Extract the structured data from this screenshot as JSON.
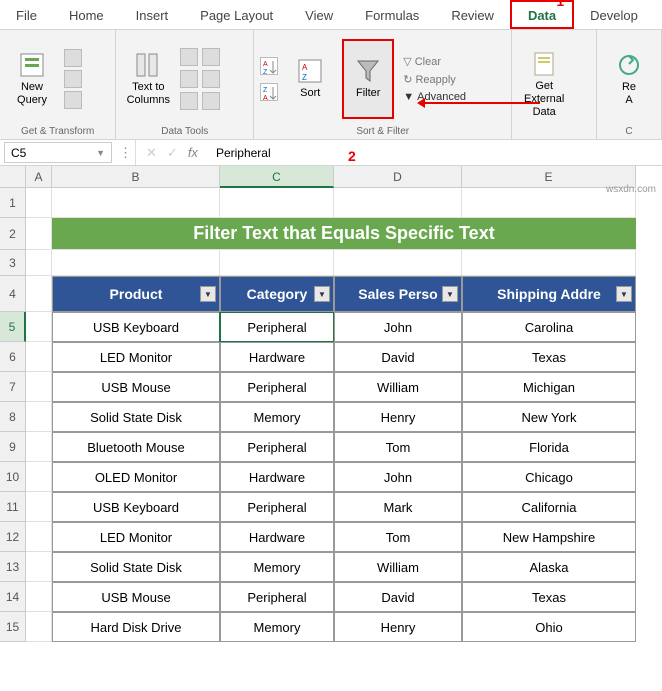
{
  "ribbon": {
    "tabs": [
      "File",
      "Home",
      "Insert",
      "Page Layout",
      "View",
      "Formulas",
      "Review",
      "Data",
      "Develop"
    ],
    "active_tab": "Data",
    "groups": {
      "get_transform": {
        "label": "Get & Transform",
        "new_query": "New\nQuery"
      },
      "data_tools": {
        "label": "Data Tools",
        "text_to_columns": "Text to\nColumns"
      },
      "sort_filter": {
        "label": "Sort & Filter",
        "sort": "Sort",
        "filter": "Filter",
        "clear": "Clear",
        "reapply": "Reapply",
        "advanced": "Advanced"
      },
      "external": {
        "label": "",
        "get_external": "Get External\nData"
      },
      "refresh": {
        "label": "C",
        "refresh": "Re\nA"
      }
    }
  },
  "annotations": {
    "one": "1",
    "two": "2"
  },
  "namebox": "C5",
  "formula_value": "Peripheral",
  "columns": [
    "A",
    "B",
    "C",
    "D",
    "E"
  ],
  "banner_title": "Filter Text that Equals Specific Text",
  "headers": [
    "Product",
    "Category",
    "Sales Perso",
    "Shipping Addre"
  ],
  "rows": [
    {
      "n": 5,
      "product": "USB Keyboard",
      "category": "Peripheral",
      "person": "John",
      "addr": "Carolina"
    },
    {
      "n": 6,
      "product": "LED Monitor",
      "category": "Hardware",
      "person": "David",
      "addr": "Texas"
    },
    {
      "n": 7,
      "product": "USB Mouse",
      "category": "Peripheral",
      "person": "William",
      "addr": "Michigan"
    },
    {
      "n": 8,
      "product": "Solid State Disk",
      "category": "Memory",
      "person": "Henry",
      "addr": "New York"
    },
    {
      "n": 9,
      "product": "Bluetooth Mouse",
      "category": "Peripheral",
      "person": "Tom",
      "addr": "Florida"
    },
    {
      "n": 10,
      "product": "OLED Monitor",
      "category": "Hardware",
      "person": "John",
      "addr": "Chicago"
    },
    {
      "n": 11,
      "product": "USB Keyboard",
      "category": "Peripheral",
      "person": "Mark",
      "addr": "California"
    },
    {
      "n": 12,
      "product": "LED Monitor",
      "category": "Hardware",
      "person": "Tom",
      "addr": "New Hampshire"
    },
    {
      "n": 13,
      "product": "Solid State Disk",
      "category": "Memory",
      "person": "William",
      "addr": "Alaska"
    },
    {
      "n": 14,
      "product": "USB Mouse",
      "category": "Peripheral",
      "person": "David",
      "addr": "Texas"
    },
    {
      "n": 15,
      "product": "Hard Disk Drive",
      "category": "Memory",
      "person": "Henry",
      "addr": "Ohio"
    }
  ],
  "watermark": "wsxdn.com"
}
